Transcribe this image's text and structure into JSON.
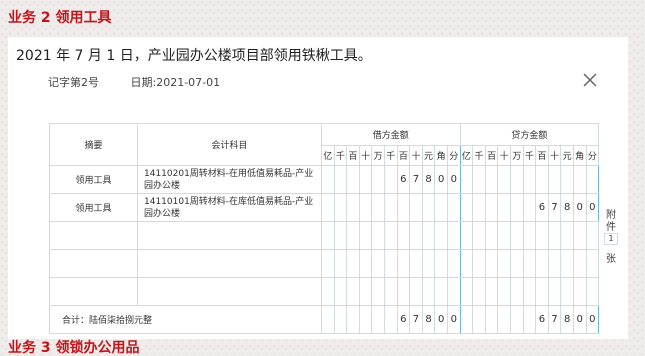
{
  "heading": "业务 2 领用工具",
  "description": "2021 年 7 月 1 日，产业园办公楼项目部领用铁楸工具。",
  "next_heading": "业务 3 领锁办公用品",
  "voucher": {
    "number": "记字第2号",
    "date": "日期:2021-07-01",
    "headers": {
      "summary": "摘要",
      "account": "会计科目",
      "debit": "借方金额",
      "credit": "贷方金额"
    },
    "units": [
      "亿",
      "千",
      "百",
      "十",
      "万",
      "千",
      "百",
      "十",
      "元",
      "角",
      "分"
    ],
    "rows": [
      {
        "summary": "领用工具",
        "account": "14110201周转材料-在用低值易耗品-产业园办公楼",
        "debit": [
          "",
          "",
          "",
          "",
          "",
          "",
          "6",
          "7",
          "8",
          "0",
          "0"
        ],
        "credit": [
          "",
          "",
          "",
          "",
          "",
          "",
          "",
          "",
          "",
          "",
          ""
        ]
      },
      {
        "summary": "领用工具",
        "account": "14110101周转材料-在库低值易耗品-产业园办公楼",
        "debit": [
          "",
          "",
          "",
          "",
          "",
          "",
          "",
          "",
          "",
          "",
          ""
        ],
        "credit": [
          "",
          "",
          "",
          "",
          "",
          "",
          "6",
          "7",
          "8",
          "0",
          "0"
        ]
      }
    ],
    "total_label": "合计：陆佰柒拾捌元整",
    "total_debit": [
      "",
      "",
      "",
      "",
      "",
      "",
      "6",
      "7",
      "8",
      "0",
      "0"
    ],
    "total_credit": [
      "",
      "",
      "",
      "",
      "",
      "",
      "6",
      "7",
      "8",
      "0",
      "0"
    ],
    "attachment": {
      "label_1": "附",
      "label_2": "件",
      "count": "1",
      "label_3": "张"
    }
  }
}
